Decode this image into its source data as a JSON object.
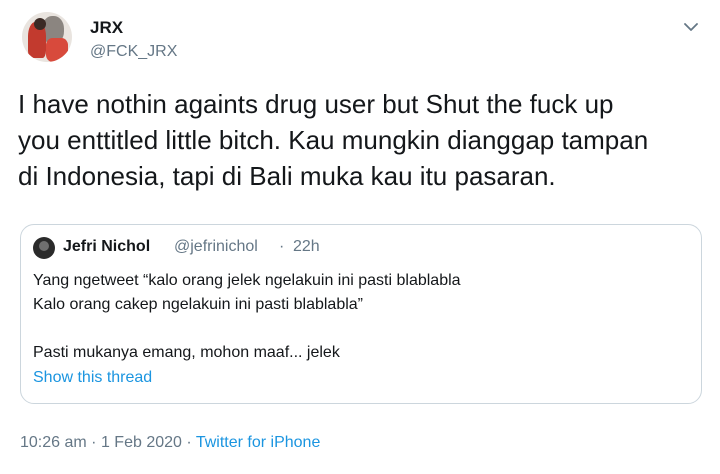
{
  "author": {
    "display_name": "JRX",
    "handle": "@FCK_JRX"
  },
  "tweet": {
    "text_lines": [
      "I have nothin againts drug user but Shut the fuck up",
      "you enttitled little bitch. Kau mungkin dianggap tampan",
      "di Indonesia, tapi di Bali muka kau itu pasaran."
    ]
  },
  "quoted_tweet": {
    "display_name": "Jefri Nichol",
    "handle": "@jefrinichol",
    "separator": "·",
    "time": "22h",
    "body_lines": [
      "Yang ngetweet “kalo orang jelek ngelakuin ini pasti blablabla",
      "Kalo orang cakep ngelakuin ini pasti blablabla”",
      "",
      "Pasti mukanya emang, mohon maaf... jelek"
    ],
    "show_thread": "Show this thread"
  },
  "meta": {
    "time": "10:26 am",
    "separator": "·",
    "date": "1 Feb 2020",
    "source": "Twitter for iPhone"
  },
  "icons": {
    "caret": "chevron-down-icon"
  },
  "colors": {
    "link": "#1b95e0",
    "secondary_text": "#657786",
    "border": "#ccd6dd"
  }
}
